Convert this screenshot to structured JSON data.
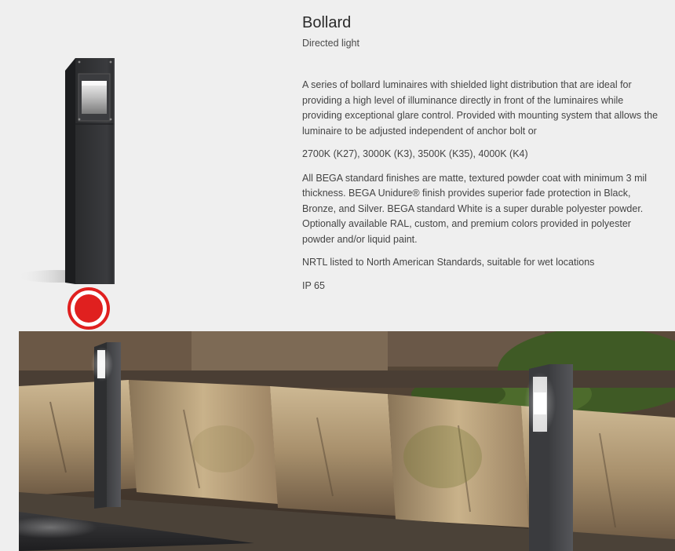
{
  "product": {
    "title": "Bollard",
    "subtitle": "Directed light",
    "description": "A series of bollard luminaires with shielded light distribution that are ideal for providing a high level of illuminance directly in front of the luminaires while providing exceptional glare control. Provided with mounting system that allows the luminaire to be adjusted independent of anchor bolt or",
    "color_temperatures": "2700K (K27), 3000K (K3), 3500K (K35), 4000K (K4)",
    "finish": "All BEGA standard finishes are matte, textured powder coat with minimum 3 mil thickness. BEGA Unidure® finish provides superior fade protection in Black, Bronze, and Silver. BEGA standard White is a super durable polyester powder. Optionally available RAL, custom, and premium colors provided in polyester powder and/or liquid paint.",
    "listing": "NRTL listed to North American Standards, suitable for wet locations",
    "ip_rating": "IP 65"
  },
  "colors": {
    "selected_swatch": "#e0201f",
    "bollard_body": "#2f3032",
    "background": "#efefef"
  },
  "icons": {
    "color_selector": "red-finish-swatch"
  }
}
